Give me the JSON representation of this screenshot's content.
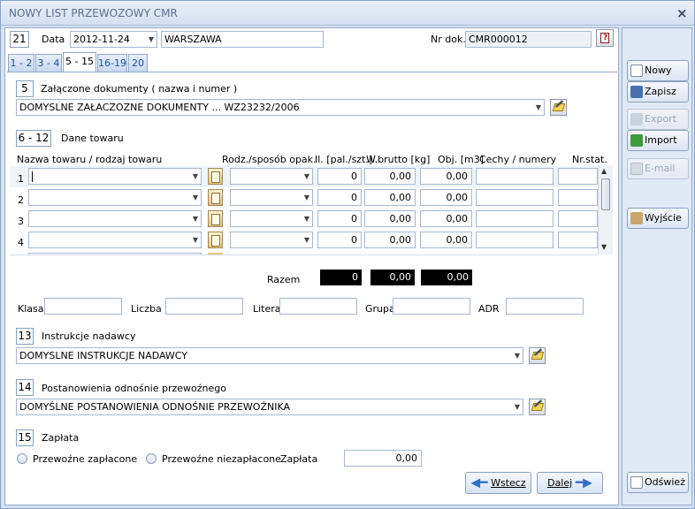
{
  "window": {
    "title": "NOWY LIST PRZEWOZOWY CMR",
    "close": "×"
  },
  "header": {
    "field_num": "21",
    "date_label": "Data",
    "date_value": "2012-11-24",
    "place_value": "WARSZAWA",
    "doc_label": "Nr dok.",
    "doc_value": "CMR000012"
  },
  "tabs": [
    "1 - 2",
    "3 - 4",
    "5 - 15",
    "16-19",
    "20"
  ],
  "sec5": {
    "num": "5",
    "label": "Załączone dokumenty ( nazwa i numer )",
    "value": "DOMYSLNE ZAŁACZOZNE DOKUMENTY ... WZ23232/2006"
  },
  "sec612": {
    "num": "6 - 12",
    "label": "Dane towaru"
  },
  "cols": {
    "c1": "Nazwa towaru / rodzaj towaru",
    "c2": "Rodz./sposób opak.",
    "c3": "Il. [pal./szt.]",
    "c4": "W.brutto [kg]",
    "c5": "Obj. [m3]",
    "c6": "Cechy / numery",
    "c7": "Nr.stat."
  },
  "rows": [
    {
      "n": "1",
      "qty": "0",
      "weight": "0,00",
      "vol": "0,00"
    },
    {
      "n": "2",
      "qty": "0",
      "weight": "0,00",
      "vol": "0,00"
    },
    {
      "n": "3",
      "qty": "0",
      "weight": "0,00",
      "vol": "0,00"
    },
    {
      "n": "4",
      "qty": "0",
      "weight": "0,00",
      "vol": "0,00"
    }
  ],
  "totals": {
    "label": "Razem",
    "qty": "0",
    "weight": "0,00",
    "vol": "0,00"
  },
  "adr": {
    "klasa": "Klasa",
    "liczba": "Liczba",
    "litera": "Litera",
    "grupa": "Grupa",
    "adr": "ADR"
  },
  "sec13": {
    "num": "13",
    "label": "Instrukcje nadawcy",
    "value": "DOMYSLNE INSTRUKCJE NADAWCY"
  },
  "sec14": {
    "num": "14",
    "label": "Postanowienia odnośnie przewoźnego",
    "value": "DOMYŚLNE POSTANOWIENIA ODNOŚNIE PRZEWOŹNIKA"
  },
  "sec15": {
    "num": "15",
    "label": "Zapłata",
    "paid": "Przewoźne zapłacone",
    "unpaid": "Przewoźne niezapłacone",
    "amount_label": "Zapłata",
    "amount": "0,00"
  },
  "nav": {
    "back": "Wstecz",
    "next": "Dalej"
  },
  "side": {
    "nowy": "Nowy",
    "zapisz": "Zapisz",
    "export": "Export",
    "import": "Import",
    "email": "E-mail",
    "wyjscie": "Wyjście",
    "odswiez": "Odśwież"
  },
  "colors": {
    "accent": "#1e4f95",
    "window_bg": "#d6e3f3",
    "arrow_blue": "#2f6fc9"
  }
}
